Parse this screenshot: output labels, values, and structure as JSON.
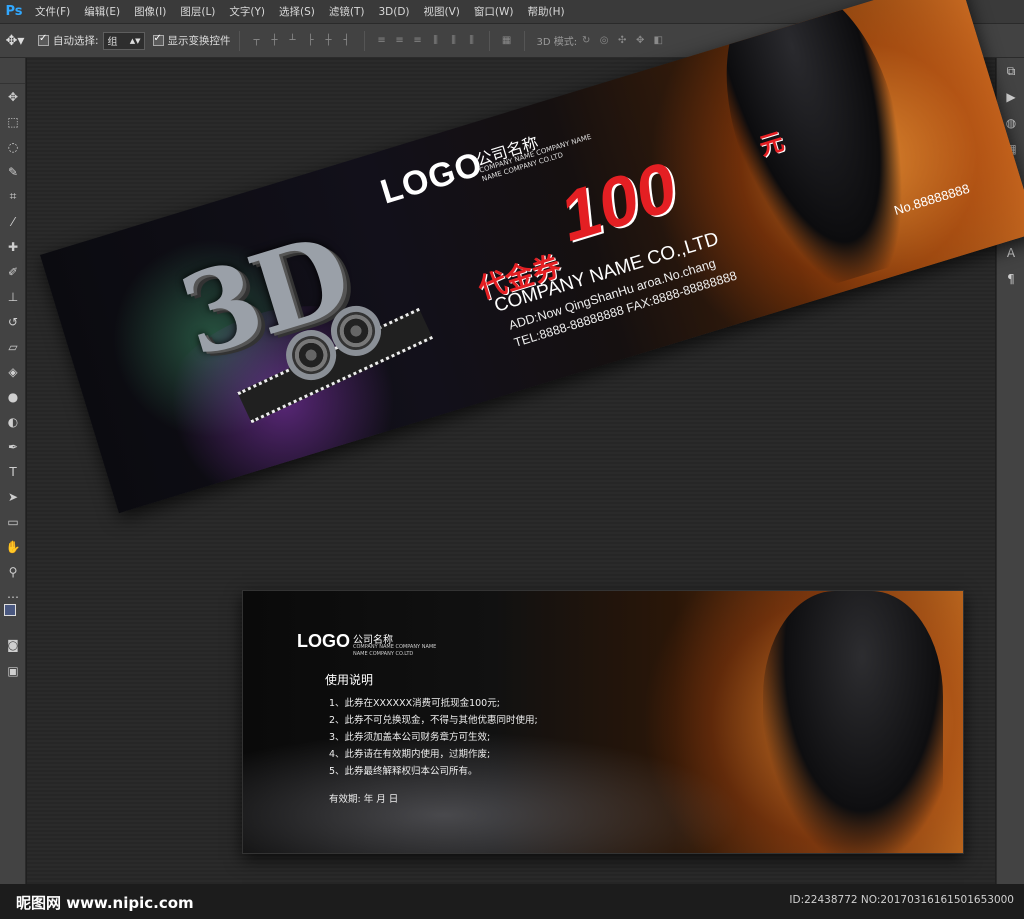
{
  "app": {
    "logo": "Ps"
  },
  "menu": [
    "文件(F)",
    "编辑(E)",
    "图像(I)",
    "图层(L)",
    "文字(Y)",
    "选择(S)",
    "滤镜(T)",
    "3D(D)",
    "视图(V)",
    "窗口(W)",
    "帮助(H)"
  ],
  "options": {
    "auto_select_label": "自动选择:",
    "auto_select_value": "组",
    "show_transform_label": "显示变换控件",
    "mode_3d_label": "3D 模式:"
  },
  "front": {
    "graphic_3d": "3D",
    "logo": "LOGO",
    "company_cn": "公司名称",
    "company_en1": "COMPANY NAME COMPANY NAME",
    "company_en2": "NAME COMPANY CO.LTD",
    "amount": "100",
    "currency": "元",
    "voucher": "代金券",
    "company_name": "COMPANY NAME CO.,LTD",
    "address": "ADD:Now QingShanHu aroa.No.chang",
    "tel_fax": "TEL:8888-88888888   FAX:8888-88888888",
    "number": "No.88888888"
  },
  "back": {
    "logo": "LOGO",
    "company_cn": "公司名称",
    "company_en1": "COMPANY NAME COMPANY NAME",
    "company_en2": "NAME COMPANY CO.LTD",
    "title": "使用说明",
    "rules": [
      "1、此券在XXXXXX消费可抵现金100元;",
      "2、此券不可兑换现金，不得与其他优惠同时使用;",
      "3、此券须加盖本公司财务章方可生效;",
      "4、此券请在有效期内使用，过期作废;",
      "5、此券最终解释权归本公司所有。"
    ],
    "validity": "有效期:        年    月    日"
  },
  "watermark": {
    "site": "昵图网 www.nipic.com",
    "id": "ID:22438772 NO:20170316161501653000"
  }
}
